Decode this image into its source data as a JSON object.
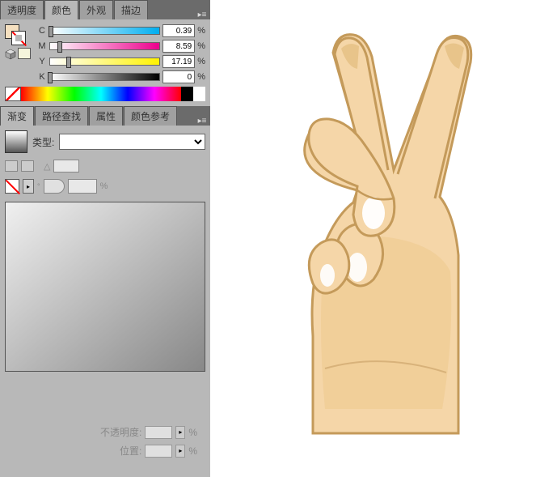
{
  "tabs_top": {
    "transparency": "透明度",
    "color": "颜色",
    "appearance": "外观",
    "stroke": "描边"
  },
  "cmyk": {
    "labels": {
      "c": "C",
      "m": "M",
      "y": "Y",
      "k": "K"
    },
    "values": {
      "c": "0.39",
      "m": "8.59",
      "y": "17.19",
      "k": "0"
    },
    "percent": "%"
  },
  "chart_data": {
    "type": "table",
    "title": "CMYK Color Values",
    "categories": [
      "C",
      "M",
      "Y",
      "K"
    ],
    "values": [
      0.39,
      8.59,
      17.19,
      0
    ],
    "unit": "%",
    "range": [
      0,
      100
    ]
  },
  "tabs_mid": {
    "gradient": "渐变",
    "pathfinder": "路径查找",
    "attributes": "属性",
    "colorguide": "颜色参考"
  },
  "gradient": {
    "type_label": "类型:",
    "type_value": "",
    "angle_placeholder": "",
    "horn_value": "",
    "horn_pct": "%"
  },
  "bottom": {
    "opacity_label": "不透明度:",
    "opacity_pct": "%",
    "position_label": "位置:",
    "position_pct": "%"
  },
  "colors": {
    "skin": "#f5d6a8",
    "skin_shadow": "#e2b97e",
    "outline": "#c49a5a",
    "nail": "#ffffff"
  }
}
